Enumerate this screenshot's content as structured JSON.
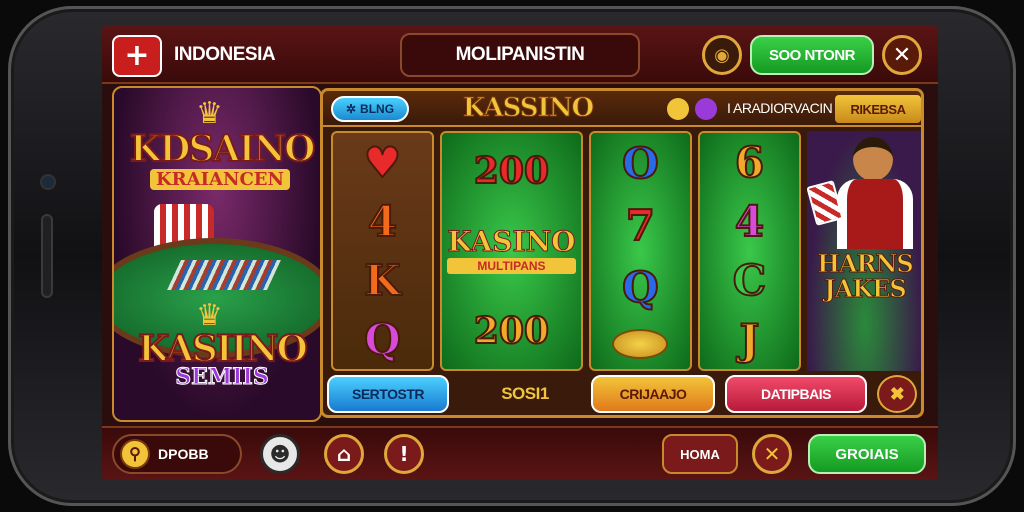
{
  "topbar": {
    "region_label": "INDONESIA",
    "title": "MOLIPANISTIN",
    "green_button": "SOO NTONR",
    "flag_icon": "plus-icon",
    "coin_icon": "coin-icon",
    "close_icon": "close-icon"
  },
  "left_panel": {
    "logo_top_line1": "KDSAINO",
    "logo_top_line2": "KRAIANCEN",
    "logo_bottom_line1": "KASIINO",
    "logo_bottom_line2": "SEMIIS"
  },
  "game": {
    "pill_label": "BLNG",
    "title": "KASSINO",
    "header_label": "I ARADIORVACIN",
    "badge_label": "RIKEBSA",
    "reel1": [
      "♥",
      "4",
      "K",
      "Q"
    ],
    "reel2_top": "200",
    "reel2_logo": "KASINO",
    "reel2_logo_sub": "MULTIPANS",
    "reel2_bottom": "200",
    "reel3": [
      "O",
      "7",
      "Q",
      "coins"
    ],
    "reel4": [
      "6",
      "4",
      "C",
      "J"
    ],
    "dealer_text_line1": "HARNS",
    "dealer_text_line2": "JAKES",
    "actions": {
      "blue": "SERTOSTR",
      "center": "SOSI1",
      "orange": "CRIJAAJO",
      "pink": "DATIPBAIS"
    }
  },
  "bottombar": {
    "search_label": "DPOBB",
    "home_label": "HOMA",
    "green_button": "GROIAIS"
  }
}
